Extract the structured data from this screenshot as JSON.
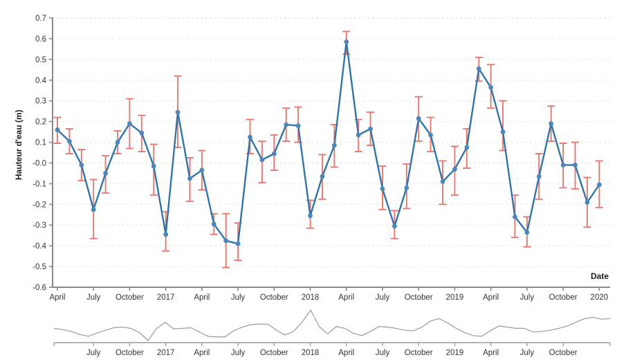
{
  "chart_data": {
    "type": "line",
    "title": "",
    "xlabel": "Date",
    "ylabel": "Hauteur d'eau (m)",
    "ylim": [
      -0.6,
      0.7
    ],
    "ytick_labels": [
      "0.7",
      "0.6",
      "0.5",
      "0.4",
      "0.3",
      "0.2",
      "0.1",
      "-0.0",
      "-0.1",
      "-0.2",
      "-0.3",
      "-0.4",
      "-0.5",
      "-0.6"
    ],
    "ytick_values": [
      0.7,
      0.6,
      0.5,
      0.4,
      0.3,
      0.2,
      0.1,
      0.0,
      -0.1,
      -0.2,
      -0.3,
      -0.4,
      -0.5,
      -0.6
    ],
    "xtick_labels": [
      "April",
      "July",
      "October",
      "2017",
      "April",
      "July",
      "October",
      "2018",
      "April",
      "July",
      "October",
      "2019",
      "April",
      "July",
      "October",
      "2020"
    ],
    "xtick_x": [
      "2016-04",
      "2016-07",
      "2016-10",
      "2017-01",
      "2017-04",
      "2017-07",
      "2017-10",
      "2018-01",
      "2018-04",
      "2018-07",
      "2018-10",
      "2019-01",
      "2019-04",
      "2019-07",
      "2019-10",
      "2020-01"
    ],
    "grid": "horizontal-dotted",
    "legend": "none",
    "line_color": "#2e74a8",
    "marker_color": "#4a87ba",
    "errorbar_color": "#e8766e",
    "grid_color": "#e9e9ee",
    "axis_color": "#888888",
    "x": [
      "2016-04",
      "2016-05",
      "2016-06",
      "2016-07",
      "2016-08",
      "2016-09",
      "2016-10",
      "2016-11",
      "2016-12",
      "2017-01",
      "2017-02",
      "2017-03",
      "2017-04",
      "2017-05",
      "2017-06",
      "2017-07",
      "2017-08",
      "2017-09",
      "2017-10",
      "2017-11",
      "2017-12",
      "2018-01",
      "2018-02",
      "2018-03",
      "2018-04",
      "2018-05",
      "2018-06",
      "2018-07",
      "2018-08",
      "2018-09",
      "2018-10",
      "2018-11",
      "2018-12",
      "2019-01",
      "2019-02",
      "2019-03",
      "2019-04",
      "2019-05",
      "2019-06",
      "2019-07",
      "2019-08",
      "2019-09",
      "2019-10",
      "2019-11",
      "2019-12",
      "2020-01"
    ],
    "series": [
      {
        "name": "Hauteur d'eau",
        "values": [
          0.16,
          0.105,
          -0.01,
          -0.225,
          -0.05,
          0.1,
          0.19,
          0.145,
          -0.015,
          -0.345,
          0.245,
          -0.075,
          -0.035,
          -0.295,
          -0.375,
          -0.39,
          0.125,
          0.015,
          0.045,
          0.185,
          0.18,
          -0.255,
          -0.065,
          0.085,
          0.585,
          0.135,
          0.165,
          -0.125,
          -0.305,
          -0.12,
          0.215,
          0.135,
          -0.09,
          -0.03,
          0.075,
          0.455,
          0.365,
          0.15,
          -0.26,
          -0.335,
          -0.065,
          0.19,
          -0.01,
          -0.01,
          -0.19,
          -0.105
        ],
        "err_low": [
          0.095,
          0.045,
          -0.085,
          -0.365,
          -0.145,
          0.045,
          0.07,
          0.055,
          -0.155,
          -0.425,
          0.075,
          -0.185,
          -0.13,
          -0.345,
          -0.505,
          -0.47,
          0.045,
          -0.095,
          -0.035,
          0.105,
          0.1,
          -0.315,
          -0.175,
          -0.02,
          0.525,
          0.055,
          0.085,
          -0.225,
          -0.365,
          -0.22,
          0.105,
          0.055,
          -0.2,
          -0.155,
          -0.025,
          0.395,
          0.265,
          0.06,
          -0.36,
          -0.405,
          -0.175,
          0.105,
          -0.12,
          -0.125,
          -0.31,
          -0.215
        ],
        "err_high": [
          0.22,
          0.165,
          0.065,
          -0.08,
          0.035,
          0.155,
          0.31,
          0.23,
          0.09,
          -0.235,
          0.42,
          0.025,
          0.06,
          -0.245,
          -0.245,
          -0.29,
          0.21,
          0.105,
          0.135,
          0.265,
          0.27,
          -0.18,
          0.04,
          0.185,
          0.635,
          0.21,
          0.245,
          -0.015,
          -0.23,
          -0.005,
          0.32,
          0.22,
          0.01,
          0.08,
          0.165,
          0.51,
          0.475,
          0.3,
          -0.155,
          -0.26,
          0.045,
          0.275,
          0.095,
          0.1,
          -0.07,
          0.01
        ]
      }
    ],
    "navigator": {
      "visible": true,
      "line_color": "#9a9a9a",
      "xtick_labels": [
        "July",
        "October",
        "2017",
        "April",
        "July",
        "October",
        "2018",
        "April",
        "July",
        "October",
        "2019",
        "April",
        "July",
        "October"
      ],
      "values": [
        0.3,
        0.28,
        0.25,
        0.2,
        0.17,
        0.22,
        0.27,
        0.31,
        0.32,
        0.3,
        0.23,
        0.1,
        0.3,
        0.4,
        0.29,
        0.3,
        0.31,
        0.24,
        0.17,
        0.16,
        0.16,
        0.26,
        0.32,
        0.36,
        0.37,
        0.37,
        0.27,
        0.19,
        0.25,
        0.4,
        0.6,
        0.33,
        0.21,
        0.33,
        0.3,
        0.22,
        0.18,
        0.25,
        0.33,
        0.32,
        0.3,
        0.27,
        0.26,
        0.32,
        0.42,
        0.46,
        0.39,
        0.3,
        0.23,
        0.18,
        0.17,
        0.26,
        0.34,
        0.32,
        0.3,
        0.3,
        0.24,
        0.25,
        0.27,
        0.3,
        0.34,
        0.4,
        0.46,
        0.48,
        0.45,
        0.46
      ]
    }
  },
  "axis": {
    "y_title": "Hauteur d'eau (m)",
    "x_title": "Date"
  }
}
